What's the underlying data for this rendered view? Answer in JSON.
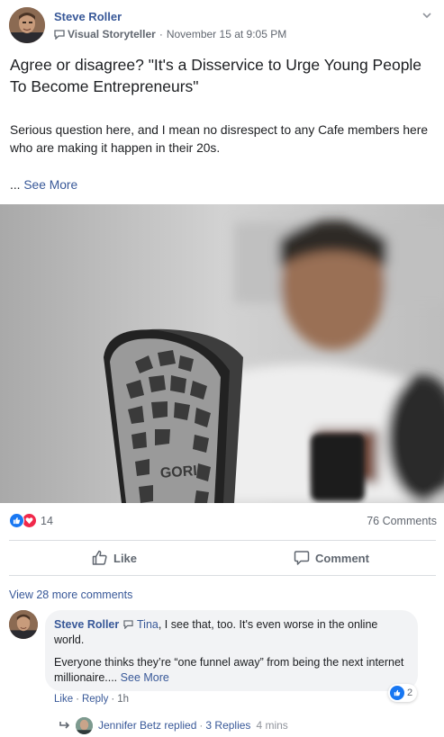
{
  "post": {
    "author": "Steve Roller",
    "badge": "Visual Storyteller",
    "timestamp": "November 15 at 9:05 PM",
    "title": "Agree or disagree? \"It's a Disservice to Urge Young People To Become Entrepreneurs\"",
    "body": "Serious question here, and I mean no disrespect to any Cafe members here who are making it happen in their 20s.",
    "see_more_prefix": "...",
    "see_more": "See More",
    "image_sole_text": "GORI"
  },
  "stats": {
    "reaction_count": "14",
    "comments_count": "76 Comments"
  },
  "actions": {
    "like": "Like",
    "comment": "Comment"
  },
  "comments": {
    "view_more": "View 28 more comments",
    "item": {
      "author": "Steve Roller",
      "mention": "Tina",
      "text1": ", I see that, too. It's even worse in the online world.",
      "text2": "Everyone thinks they’re “one funnel away” from being the next internet millionaire....",
      "see_more": "See More",
      "reaction_count": "2",
      "like": "Like",
      "reply": "Reply",
      "time": "1h"
    },
    "reply_summary": {
      "name": "Jennifer Betz replied",
      "sep": "·",
      "replies": "3 Replies",
      "time": "4 mins"
    }
  },
  "colors": {
    "link": "#385898",
    "like_blue": "#1877f2",
    "love_red": "#f0284a",
    "meta_gray": "#616770"
  }
}
